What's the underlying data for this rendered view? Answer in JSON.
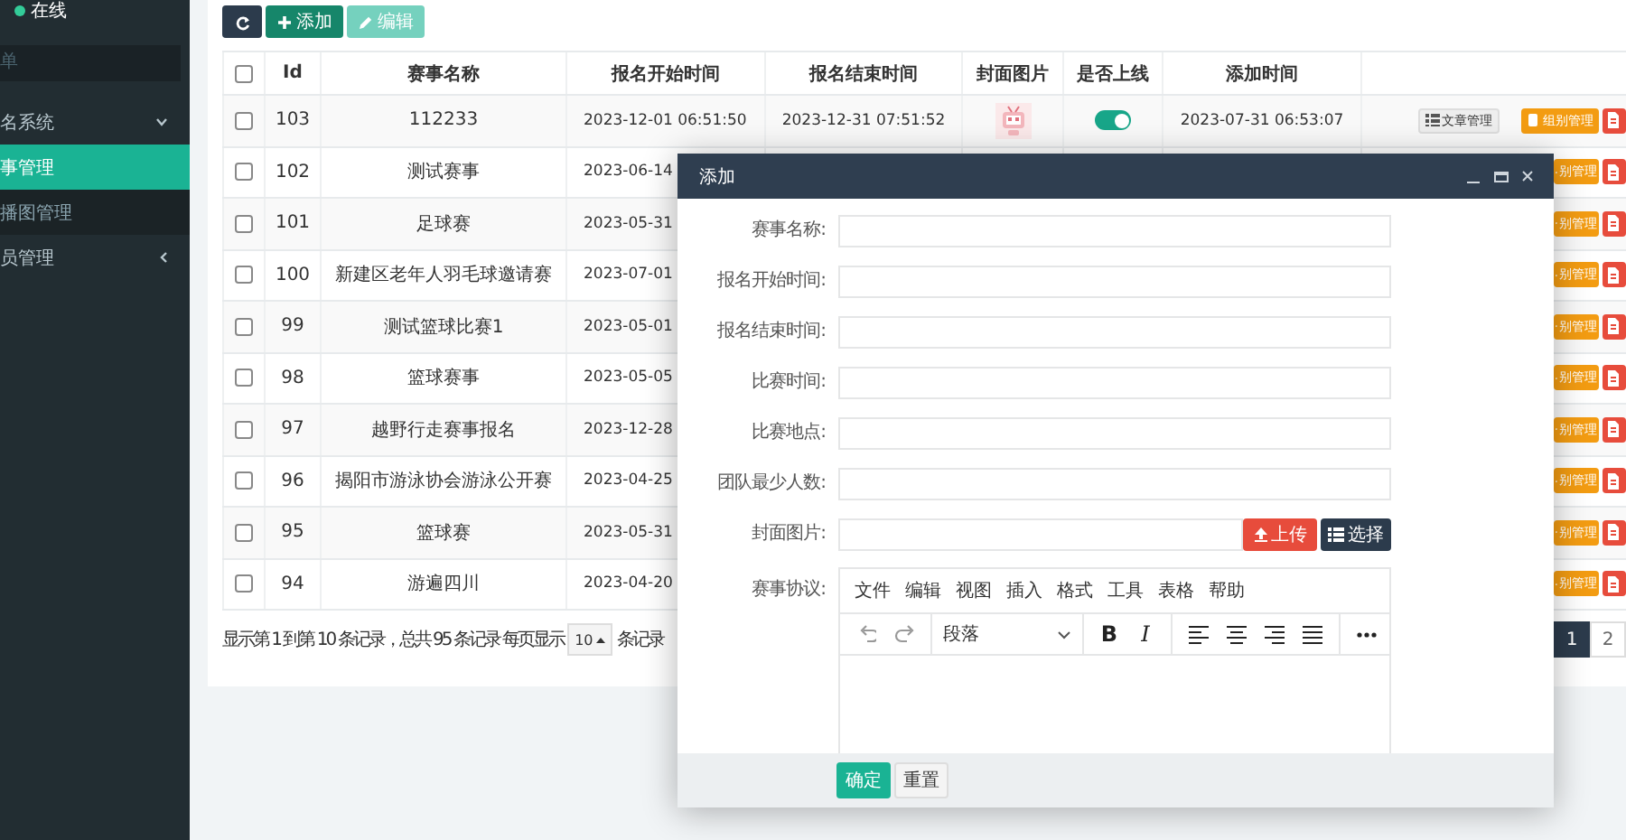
{
  "sidebar": {
    "status": "在线",
    "menu_header": "单",
    "items": [
      {
        "label": "名系统",
        "selected": false,
        "expanded": true,
        "children": [
          {
            "label": "事管理",
            "selected": true
          },
          {
            "label": "播图管理",
            "selected": false
          }
        ]
      },
      {
        "label": "员管理",
        "selected": false,
        "expanded": false
      }
    ]
  },
  "toolbar": {
    "buttons": [
      {
        "kind": "refresh",
        "disabled": false
      },
      {
        "kind": "add",
        "label": "添加",
        "disabled": false
      },
      {
        "kind": "edit",
        "label": "编辑",
        "disabled": true
      }
    ]
  },
  "table": {
    "select_all": false,
    "columns": [
      "Id",
      "赛事名称",
      "报名开始时间",
      "报名结束时间",
      "封面图片",
      "是否上线",
      "添加时间"
    ],
    "rows": [
      {
        "checked": false,
        "id": "103",
        "name": "112233",
        "start": "2023-12-01 06:51:50",
        "end": "2023-12-31 07:51:52",
        "online": true,
        "added": "2023-07-31 06:53:07",
        "actions": [
          {
            "kind": "articles",
            "label": "文章管理"
          },
          {
            "kind": "groups",
            "label": "组别管理"
          },
          {
            "kind": "delete"
          }
        ]
      },
      {
        "checked": false,
        "id": "102",
        "name": "测试赛事",
        "start": "2023-06-14",
        "actions": [
          {
            "kind": "groups",
            "label": "别管理"
          },
          {
            "kind": "delete"
          }
        ]
      },
      {
        "checked": false,
        "id": "101",
        "name": "足球赛",
        "start": "2023-05-31",
        "actions": [
          {
            "kind": "groups",
            "label": "别管理"
          },
          {
            "kind": "delete"
          }
        ]
      },
      {
        "checked": false,
        "id": "100",
        "name": "新建区老年人羽毛球邀请赛",
        "start": "2023-07-01",
        "actions": [
          {
            "kind": "groups",
            "label": "别管理"
          },
          {
            "kind": "delete"
          }
        ]
      },
      {
        "checked": false,
        "id": "99",
        "name": "测试篮球比赛1",
        "start": "2023-05-01",
        "actions": [
          {
            "kind": "groups",
            "label": "别管理"
          },
          {
            "kind": "delete"
          }
        ]
      },
      {
        "checked": false,
        "id": "98",
        "name": "篮球赛事",
        "start": "2023-05-05",
        "actions": [
          {
            "kind": "groups",
            "label": "别管理"
          },
          {
            "kind": "delete"
          }
        ]
      },
      {
        "checked": false,
        "id": "97",
        "name": "越野行走赛事报名",
        "start": "2023-12-28",
        "actions": [
          {
            "kind": "groups",
            "label": "别管理"
          },
          {
            "kind": "delete"
          }
        ]
      },
      {
        "checked": false,
        "id": "96",
        "name": "揭阳市游泳协会游泳公开赛",
        "start": "2023-04-25",
        "actions": [
          {
            "kind": "groups",
            "label": "别管理"
          },
          {
            "kind": "delete"
          }
        ]
      },
      {
        "checked": false,
        "id": "95",
        "name": "篮球赛",
        "start": "2023-05-31",
        "actions": [
          {
            "kind": "groups",
            "label": "别管理"
          },
          {
            "kind": "delete"
          }
        ]
      },
      {
        "checked": false,
        "id": "94",
        "name": "游遍四川",
        "start": "2023-04-20",
        "actions": [
          {
            "kind": "groups",
            "label": "别管理"
          },
          {
            "kind": "delete"
          }
        ]
      }
    ]
  },
  "pagination": {
    "summary": "显示第 1 到第 10 条记录，总共 95 条记录 每页显示",
    "page_size": "10",
    "suffix": "条记录",
    "pages": [
      {
        "label": "1",
        "selected": true
      },
      {
        "label": "2",
        "selected": false
      }
    ]
  },
  "dialog": {
    "title": "添加",
    "fields": [
      {
        "kind": "text",
        "label": "赛事名称:"
      },
      {
        "kind": "text",
        "label": "报名开始时间:"
      },
      {
        "kind": "text",
        "label": "报名结束时间:"
      },
      {
        "kind": "text",
        "label": "比赛时间:"
      },
      {
        "kind": "text",
        "label": "比赛地点:"
      },
      {
        "kind": "text",
        "label": "团队最少人数:"
      },
      {
        "kind": "upload",
        "label": "封面图片:",
        "buttons": [
          {
            "kind": "upload",
            "label": "上传"
          },
          {
            "kind": "choose",
            "label": "选择"
          }
        ]
      },
      {
        "kind": "editor",
        "label": "赛事协议:",
        "menu": [
          "文件",
          "编辑",
          "视图",
          "插入",
          "格式",
          "工具",
          "表格",
          "帮助"
        ],
        "tools": [
          {
            "kind": "undo"
          },
          {
            "kind": "redo"
          },
          {
            "kind": "select",
            "label": "段落"
          },
          {
            "kind": "bold",
            "label": "B"
          },
          {
            "kind": "italic",
            "label": "I"
          },
          {
            "kind": "align-left"
          },
          {
            "kind": "align-center"
          },
          {
            "kind": "align-right"
          },
          {
            "kind": "align-justify"
          },
          {
            "kind": "more"
          }
        ]
      }
    ],
    "buttons": [
      {
        "kind": "primary",
        "label": "确定"
      },
      {
        "kind": "default",
        "label": "重置"
      }
    ]
  }
}
